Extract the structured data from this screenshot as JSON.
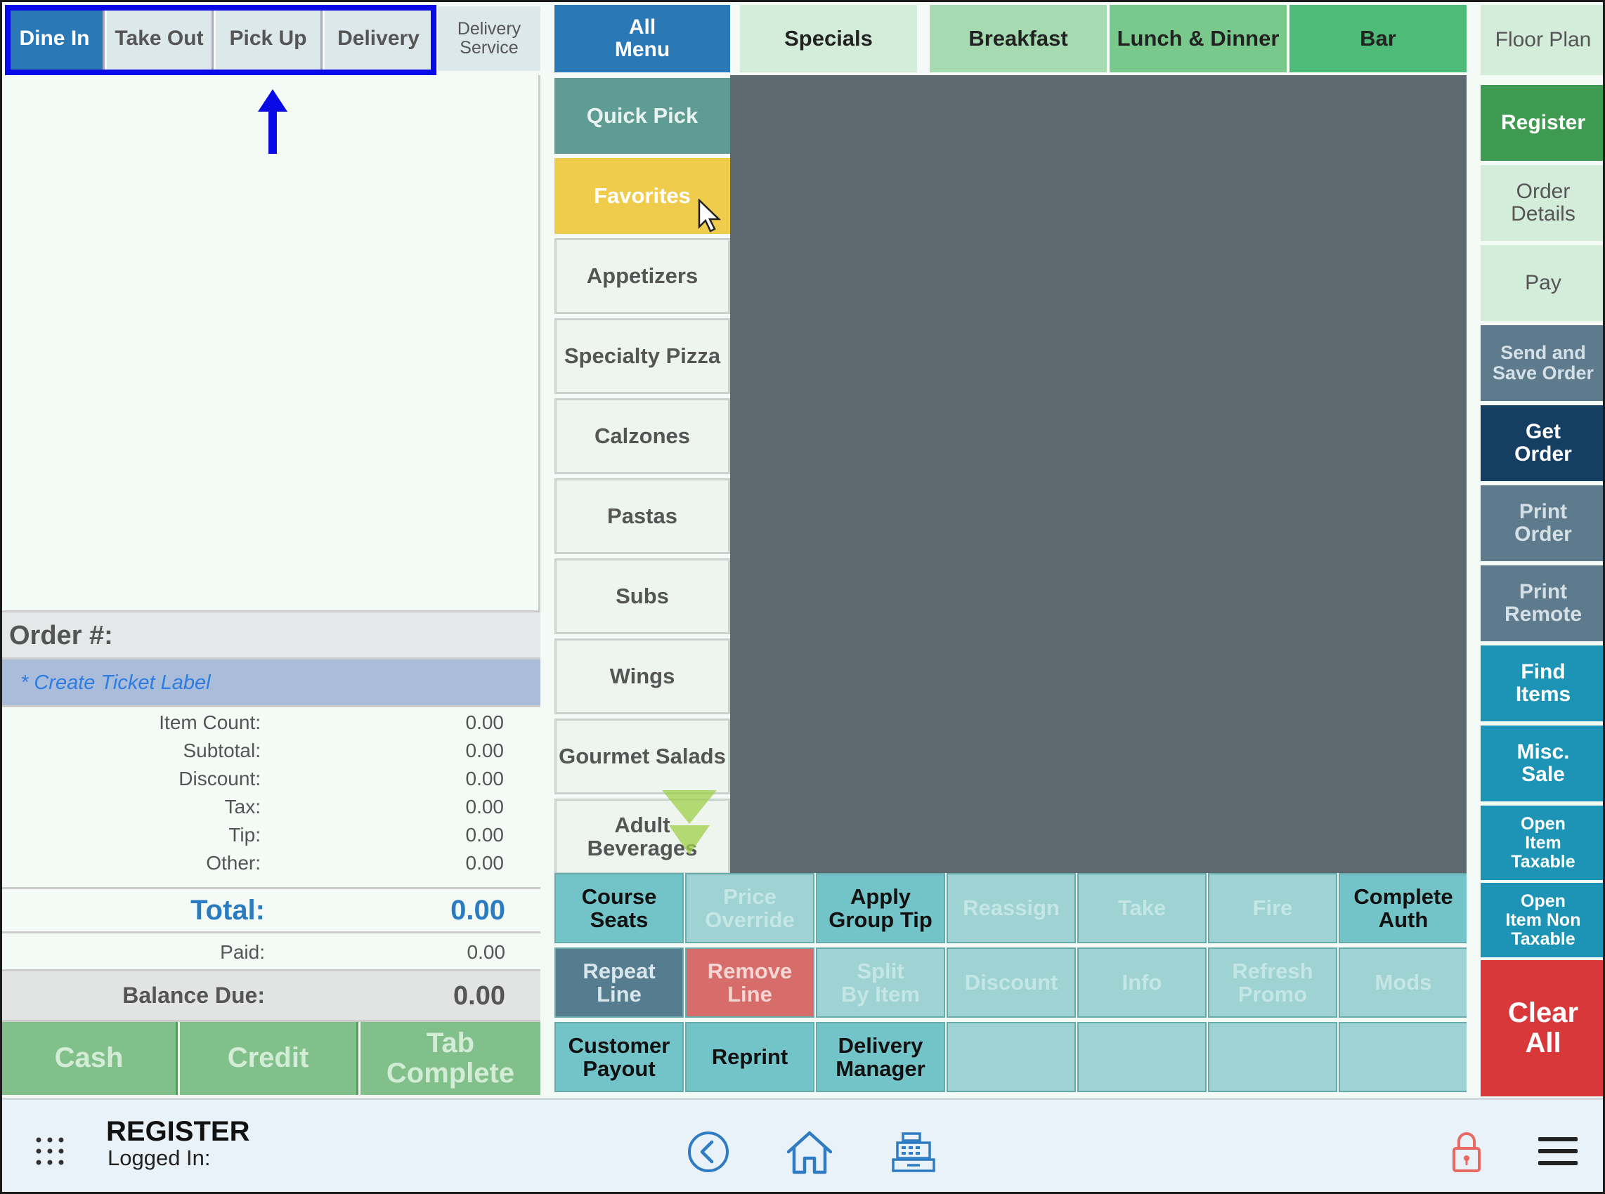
{
  "order_types": {
    "dine_in": "Dine In",
    "take_out": "Take Out",
    "pick_up": "Pick Up",
    "delivery": "Delivery",
    "delivery_service": "Delivery\nService"
  },
  "menu_tabs": {
    "all_menu": "All\nMenu",
    "specials": "Specials",
    "breakfast": "Breakfast",
    "lunch_dinner": "Lunch & Dinner",
    "bar": "Bar"
  },
  "categories": [
    "Quick Pick",
    "Favorites",
    "Appetizers",
    "Specialty Pizza",
    "Calzones",
    "Pastas",
    "Subs",
    "Wings",
    "Gourmet Salads",
    "Adult Beverages"
  ],
  "right_column": {
    "floor_plan": "Floor Plan",
    "register": "Register",
    "order_details": "Order\nDetails",
    "pay": "Pay",
    "send_save": "Send and\nSave Order",
    "get_order": "Get\nOrder",
    "print_order": "Print\nOrder",
    "print_remote": "Print\nRemote",
    "find_items": "Find\nItems",
    "misc_sale": "Misc.\nSale",
    "open_item_taxable": "Open\nItem\nTaxable",
    "open_item_non_taxable": "Open\nItem Non\nTaxable",
    "clear_all": "Clear\nAll"
  },
  "actions": {
    "row1": [
      "Course\nSeats",
      "Price\nOverride",
      "Apply\nGroup Tip",
      "Reassign",
      "Take",
      "Fire",
      "Complete\nAuth"
    ],
    "row2": [
      "Repeat\nLine",
      "Remove\nLine",
      "Split\nBy Item",
      "Discount",
      "Info",
      "Refresh\nPromo",
      "Mods"
    ],
    "row3": [
      "Customer\nPayout",
      "Reprint",
      "Delivery\nManager",
      "",
      "",
      "",
      ""
    ]
  },
  "order": {
    "order_number_label": "Order #:",
    "ticket_label_link": "* Create Ticket Label",
    "summary": [
      {
        "label": "Item Count:",
        "value": "0.00"
      },
      {
        "label": "Subtotal:",
        "value": "0.00"
      },
      {
        "label": "Discount:",
        "value": "0.00"
      },
      {
        "label": "Tax:",
        "value": "0.00"
      },
      {
        "label": "Tip:",
        "value": "0.00"
      },
      {
        "label": "Other:",
        "value": "0.00"
      }
    ],
    "total_label": "Total:",
    "total_value": "0.00",
    "paid_label": "Paid:",
    "paid_value": "0.00",
    "balance_label": "Balance Due:",
    "balance_value": "0.00"
  },
  "payment": {
    "cash": "Cash",
    "credit": "Credit",
    "tab_complete": "Tab\nComplete"
  },
  "bottom_bar": {
    "title": "REGISTER",
    "logged_in": "Logged In:"
  },
  "icons": {
    "apps": "apps-grid-icon",
    "back": "back-chevron-icon",
    "home": "home-icon",
    "register": "cash-register-icon",
    "lock": "lock-icon",
    "menu": "hamburger-menu-icon"
  },
  "colors": {
    "active_tab": "#2b78b6",
    "highlight_box": "#0a0ae6",
    "register_green": "#3f9b52",
    "clear_red": "#d9383a",
    "teal": "#1d94b5",
    "favorites_yellow": "#efcc4b"
  }
}
